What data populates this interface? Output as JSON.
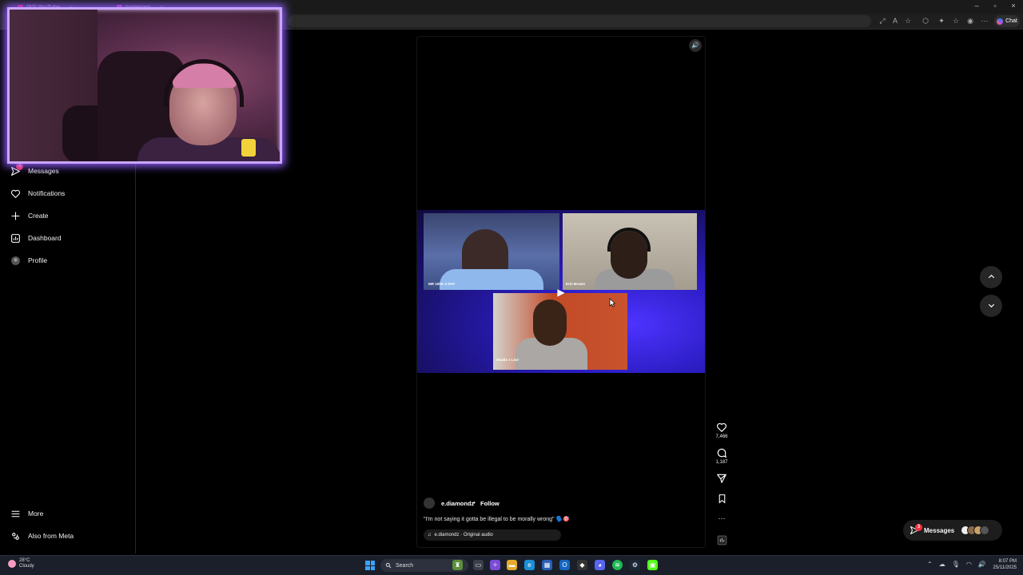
{
  "browser": {
    "tabs": [
      {
        "label": "(92) YouTube"
      },
      {
        "label": "Instagram"
      }
    ]
  },
  "sidebar": {
    "items": [
      {
        "label": "Messages",
        "icon": "send-icon",
        "badge": "3"
      },
      {
        "label": "Notifications",
        "icon": "heart-icon"
      },
      {
        "label": "Create",
        "icon": "plus-icon"
      },
      {
        "label": "Dashboard",
        "icon": "dashboard-icon"
      },
      {
        "label": "Profile",
        "icon": "profile-icon"
      }
    ],
    "bottom": [
      {
        "label": "More",
        "icon": "menu-icon"
      },
      {
        "label": "Also from Meta",
        "icon": "meta-icon"
      }
    ]
  },
  "reel": {
    "participants": [
      {
        "label": "MR 100K A DAY"
      },
      {
        "label": "Erin Brown"
      },
      {
        "label": "Studio 1 Live"
      }
    ],
    "likes": "7,466",
    "comments": "1,187",
    "author": "e.diamondz",
    "separator": "•",
    "follow_label": "Follow",
    "caption": "\"I'm not saying it gotta be illegal to be morally wrong\" 🗣️🎯",
    "audio": "e.diamondz · Original audio"
  },
  "messages_pill": {
    "label": "Messages",
    "badge": "3"
  },
  "chat_button": "Chat",
  "taskbar": {
    "weather_temp": "28°C",
    "weather_desc": "Cloudy",
    "search_label": "Search",
    "time": "8:07 PM",
    "date": "25/11/2025"
  },
  "colors": {
    "accent": "#0095f6",
    "badge": "#ff3040",
    "webcam_border": "#c9a6ff"
  }
}
